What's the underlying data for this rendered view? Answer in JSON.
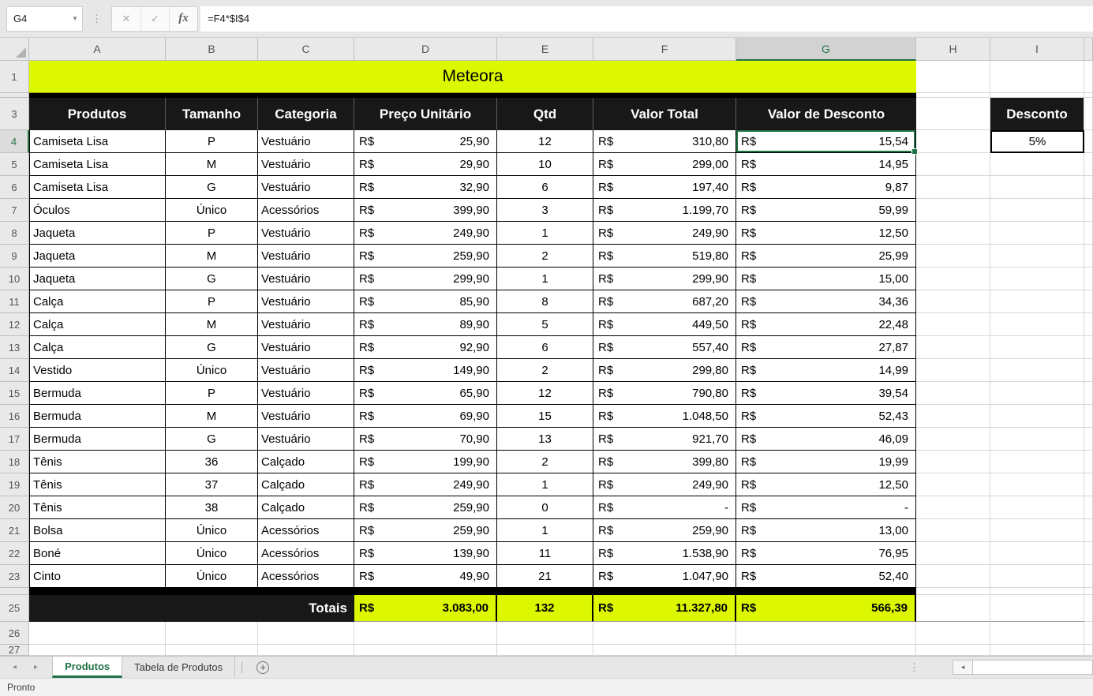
{
  "formula_bar": {
    "name_box_value": "G4",
    "formula": "=F4*$I$4"
  },
  "icons": {
    "name_box_dropdown": "▾",
    "cancel": "✕",
    "enter": "✓",
    "fx": "fx",
    "tab_prev": "◂",
    "tab_next": "▸",
    "add_sheet": "+",
    "hscroll_left": "◂",
    "drag_dots": "⋮"
  },
  "grid": {
    "column_letters": [
      "A",
      "B",
      "C",
      "D",
      "E",
      "F",
      "G",
      "H",
      "I"
    ],
    "visible_row_numbers": [
      "1",
      "3",
      "4",
      "5",
      "6",
      "7",
      "8",
      "9",
      "10",
      "11",
      "12",
      "13",
      "14",
      "15",
      "16",
      "17",
      "18",
      "19",
      "20",
      "21",
      "22",
      "23",
      "25",
      "26",
      "27"
    ],
    "selected_column": "G",
    "selected_row": "4",
    "active_cell": "G4"
  },
  "title": {
    "text": "Meteora"
  },
  "table": {
    "currency_symbol": "R$",
    "headers": [
      "Produtos",
      "Tamanho",
      "Categoria",
      "Preço Unitário",
      "Qtd",
      "Valor Total",
      "Valor de Desconto"
    ],
    "rows": [
      {
        "produto": "Camiseta Lisa",
        "tamanho": "P",
        "categoria": "Vestuário",
        "preco": "25,90",
        "qtd": "12",
        "total": "310,80",
        "desconto": "15,54"
      },
      {
        "produto": "Camiseta Lisa",
        "tamanho": "M",
        "categoria": "Vestuário",
        "preco": "29,90",
        "qtd": "10",
        "total": "299,00",
        "desconto": "14,95"
      },
      {
        "produto": "Camiseta Lisa",
        "tamanho": "G",
        "categoria": "Vestuário",
        "preco": "32,90",
        "qtd": "6",
        "total": "197,40",
        "desconto": "9,87"
      },
      {
        "produto": "Óculos",
        "tamanho": "Único",
        "categoria": "Acessórios",
        "preco": "399,90",
        "qtd": "3",
        "total": "1.199,70",
        "desconto": "59,99"
      },
      {
        "produto": "Jaqueta",
        "tamanho": "P",
        "categoria": "Vestuário",
        "preco": "249,90",
        "qtd": "1",
        "total": "249,90",
        "desconto": "12,50"
      },
      {
        "produto": "Jaqueta",
        "tamanho": "M",
        "categoria": "Vestuário",
        "preco": "259,90",
        "qtd": "2",
        "total": "519,80",
        "desconto": "25,99"
      },
      {
        "produto": "Jaqueta",
        "tamanho": "G",
        "categoria": "Vestuário",
        "preco": "299,90",
        "qtd": "1",
        "total": "299,90",
        "desconto": "15,00"
      },
      {
        "produto": "Calça",
        "tamanho": "P",
        "categoria": "Vestuário",
        "preco": "85,90",
        "qtd": "8",
        "total": "687,20",
        "desconto": "34,36"
      },
      {
        "produto": "Calça",
        "tamanho": "M",
        "categoria": "Vestuário",
        "preco": "89,90",
        "qtd": "5",
        "total": "449,50",
        "desconto": "22,48"
      },
      {
        "produto": "Calça",
        "tamanho": "G",
        "categoria": "Vestuário",
        "preco": "92,90",
        "qtd": "6",
        "total": "557,40",
        "desconto": "27,87"
      },
      {
        "produto": "Vestido",
        "tamanho": "Único",
        "categoria": "Vestuário",
        "preco": "149,90",
        "qtd": "2",
        "total": "299,80",
        "desconto": "14,99"
      },
      {
        "produto": "Bermuda",
        "tamanho": "P",
        "categoria": "Vestuário",
        "preco": "65,90",
        "qtd": "12",
        "total": "790,80",
        "desconto": "39,54"
      },
      {
        "produto": "Bermuda",
        "tamanho": "M",
        "categoria": "Vestuário",
        "preco": "69,90",
        "qtd": "15",
        "total": "1.048,50",
        "desconto": "52,43"
      },
      {
        "produto": "Bermuda",
        "tamanho": "G",
        "categoria": "Vestuário",
        "preco": "70,90",
        "qtd": "13",
        "total": "921,70",
        "desconto": "46,09"
      },
      {
        "produto": "Tênis",
        "tamanho": "36",
        "categoria": "Calçado",
        "preco": "199,90",
        "qtd": "2",
        "total": "399,80",
        "desconto": "19,99"
      },
      {
        "produto": "Tênis",
        "tamanho": "37",
        "categoria": "Calçado",
        "preco": "249,90",
        "qtd": "1",
        "total": "249,90",
        "desconto": "12,50"
      },
      {
        "produto": "Tênis",
        "tamanho": "38",
        "categoria": "Calçado",
        "preco": "259,90",
        "qtd": "0",
        "total": "-",
        "desconto": "-"
      },
      {
        "produto": "Bolsa",
        "tamanho": "Único",
        "categoria": "Acessórios",
        "preco": "259,90",
        "qtd": "1",
        "total": "259,90",
        "desconto": "13,00"
      },
      {
        "produto": "Boné",
        "tamanho": "Único",
        "categoria": "Acessórios",
        "preco": "139,90",
        "qtd": "11",
        "total": "1.538,90",
        "desconto": "76,95"
      },
      {
        "produto": "Cinto",
        "tamanho": "Único",
        "categoria": "Acessórios",
        "preco": "49,90",
        "qtd": "21",
        "total": "1.047,90",
        "desconto": "52,40"
      }
    ],
    "totals": {
      "label": "Totais",
      "preco": "3.083,00",
      "qtd": "132",
      "total": "11.327,80",
      "desconto": "566,39"
    }
  },
  "side_panel": {
    "header": "Desconto",
    "value": "5%"
  },
  "sheet_tabs": {
    "tabs": [
      {
        "label": "Produtos",
        "active": true
      },
      {
        "label": "Tabela de Produtos",
        "active": false
      }
    ]
  },
  "status_bar": {
    "text": "Pronto"
  },
  "colors": {
    "accent_yellow": "#DCF700",
    "header_black": "#181818",
    "excel_green": "#217346"
  }
}
